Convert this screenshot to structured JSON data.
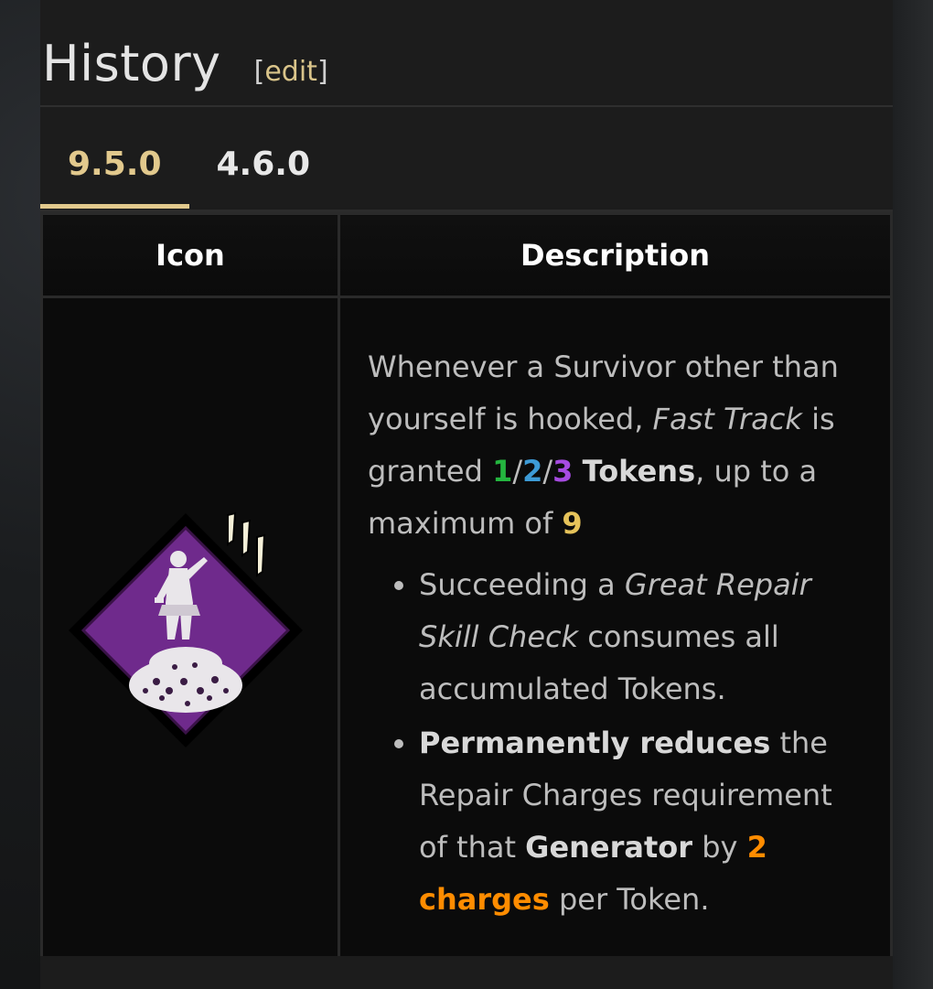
{
  "section": {
    "heading": "History",
    "edit_open": "[",
    "edit_label": "edit",
    "edit_close": "]"
  },
  "tabs": [
    {
      "label": "9.5.0",
      "active": true
    },
    {
      "label": "4.6.0",
      "active": false
    }
  ],
  "table": {
    "col_icon": "Icon",
    "col_desc": "Description"
  },
  "description": {
    "p1_a": "Whenever a Survivor other than yourself is hooked, ",
    "p1_perk": "Fast Track",
    "p1_b": " is granted ",
    "tier1": "1",
    "sep1": "/",
    "tier2": "2",
    "sep2": "/",
    "tier3": "3",
    "tokens": "Tokens",
    "p1_c": ", up to a maximum of ",
    "max": "9",
    "bullet1_a": "Succeeding a ",
    "bullet1_em": "Great Repair Skill Check",
    "bullet1_b": " consumes all accumulated Tokens.",
    "bullet2_strong": "Permanently reduces",
    "bullet2_a": " the Repair Charges requirement of that ",
    "bullet2_gen": "Generator",
    "bullet2_b": " by ",
    "bullet2_val": "2 charges",
    "bullet2_c": " per Token."
  },
  "colors": {
    "accent": "#e2c98d",
    "tier1": "#24b53f",
    "tier2": "#3d9bd6",
    "tier3": "#a64be0",
    "max": "#e6c35a",
    "charges": "#ff8c00",
    "perk_bg": "#6f2a8c"
  },
  "icons": [
    "fast-track-perk-icon"
  ]
}
